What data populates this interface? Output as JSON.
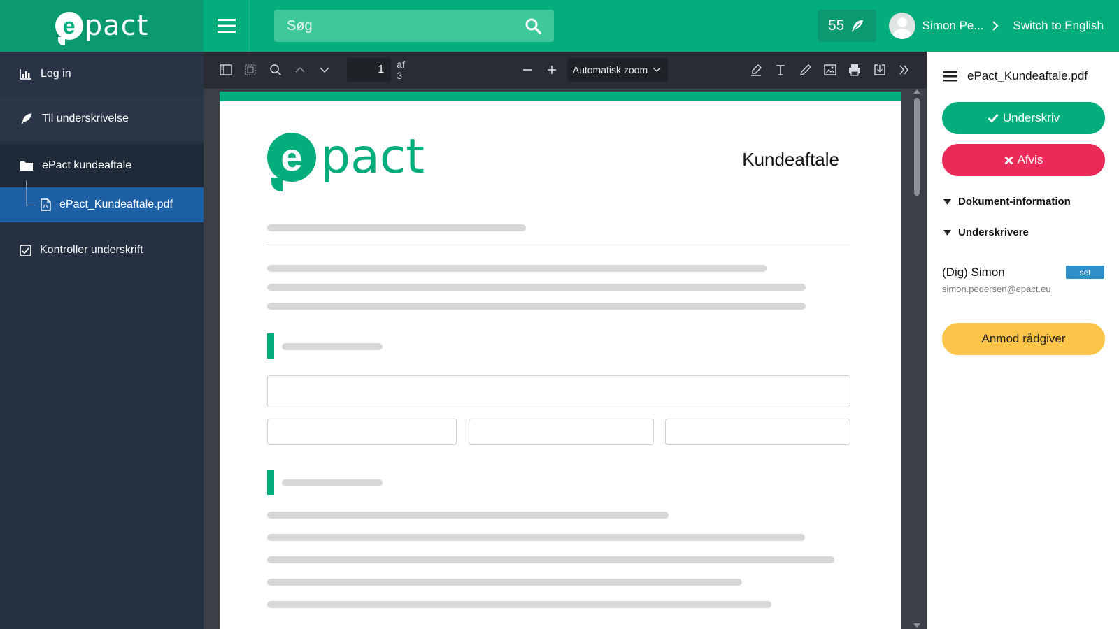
{
  "brand": {
    "logo_e": "e",
    "logo_rest": "pact"
  },
  "header": {
    "search_placeholder": "Søg",
    "counter": "55",
    "user_name": "Simon Pe...",
    "switch_language": "Switch to English"
  },
  "sidebar": {
    "items": [
      {
        "label": "Log in",
        "icon": "bar-chart-icon"
      },
      {
        "label": "Til underskrivelse",
        "icon": "feather-icon"
      },
      {
        "label": "ePact kundeaftale",
        "icon": "folder-icon"
      },
      {
        "label": "ePact_Kundeaftale.pdf",
        "icon": "pdf-file-icon"
      },
      {
        "label": "Kontroller underskrift",
        "icon": "checkbox-icon"
      }
    ]
  },
  "viewer": {
    "page_number": "1",
    "page_count_label": "af 3",
    "zoom": "Automatisk zoom"
  },
  "document": {
    "logo_e": "e",
    "logo_rest": "pact",
    "title": "Kundeaftale"
  },
  "panel": {
    "filename": "ePact_Kundeaftale.pdf",
    "sign_label": "Underskriv",
    "reject_label": "Afvis",
    "section_info": "Dokument-information",
    "section_signers": "Underskrivere",
    "signer_name": "(Dig) Simon",
    "signer_email": "simon.pedersen@epact.eu",
    "signer_badge": "set",
    "advisor_label": "Anmod rådgiver"
  },
  "colors": {
    "brand_green": "#03ad7c",
    "sidebar_bg": "#253142",
    "selected_blue": "#1d5fa5",
    "reject_red": "#ea2a58",
    "advisor_yellow": "#fcc54a",
    "badge_blue": "#2f8fc9"
  }
}
